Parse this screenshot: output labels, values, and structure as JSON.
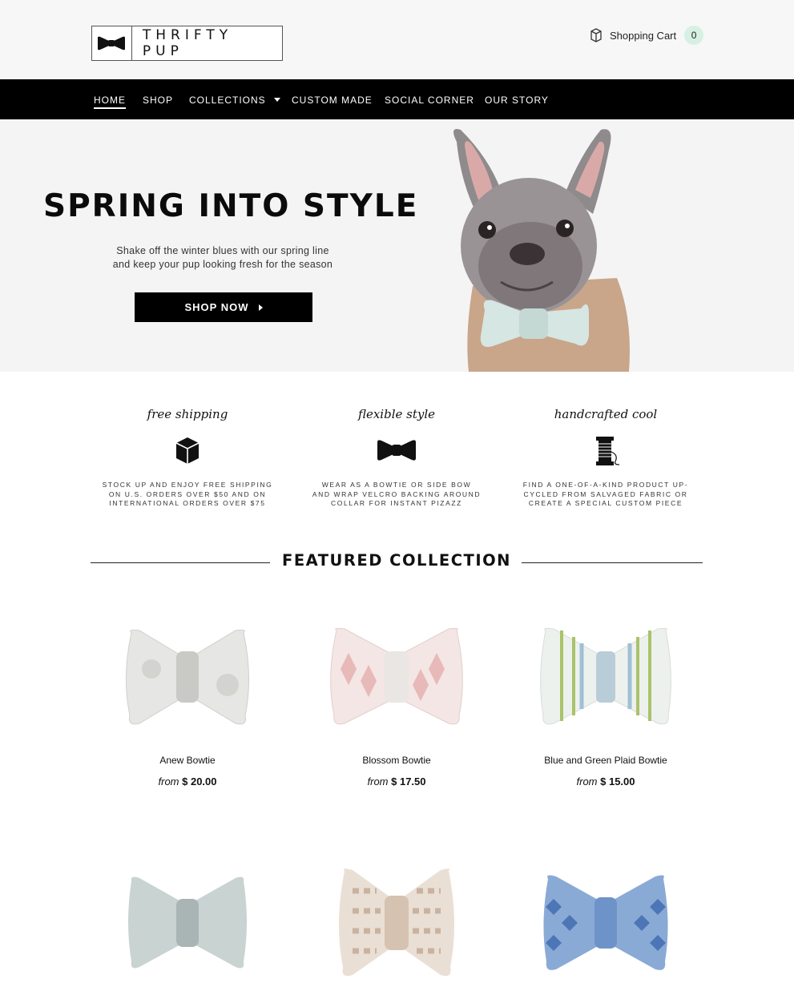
{
  "header": {
    "logo_text": "THRIFTY PUP",
    "cart_label": "Shopping Cart",
    "cart_count": "0"
  },
  "nav": {
    "items": [
      {
        "label": "HOME",
        "active": true
      },
      {
        "label": "SHOP"
      },
      {
        "label": "COLLECTIONS",
        "has_dropdown": true
      },
      {
        "label": "CUSTOM MADE"
      },
      {
        "label": "SOCIAL CORNER"
      },
      {
        "label": "OUR STORY"
      }
    ]
  },
  "hero": {
    "title": "SPRING INTO STYLE",
    "subtitle_line1": "Shake off the winter blues with our spring line",
    "subtitle_line2": "and keep your pup looking fresh for the season",
    "cta_label": "SHOP NOW"
  },
  "features": [
    {
      "title": "free shipping",
      "icon": "box-icon",
      "line1": "STOCK UP AND ENJOY FREE SHIPPING",
      "line2": "ON U.S. ORDERS OVER $50 AND ON",
      "line3": "INTERNATIONAL ORDERS OVER $75"
    },
    {
      "title": "flexible style",
      "icon": "bowtie-icon",
      "line1": "WEAR AS A BOWTIE OR SIDE BOW",
      "line2": "AND WRAP VELCRO BACKING AROUND",
      "line3": "COLLAR FOR INSTANT PIZAZZ"
    },
    {
      "title": "handcrafted cool",
      "icon": "thread-spool-icon",
      "line1": "FIND A ONE-OF-A-KIND PRODUCT UP-",
      "line2": "CYCLED FROM SALVAGED FABRIC OR",
      "line3": "CREATE A SPECIAL CUSTOM PIECE"
    }
  ],
  "featured": {
    "title": "FEATURED COLLECTION"
  },
  "products": [
    {
      "name": "Anew Bowtie",
      "from": "from",
      "price": "$ 20.00",
      "colors": [
        "#e6e6e4",
        "#c9c9c6"
      ]
    },
    {
      "name": "Blossom Bowtie",
      "from": "from",
      "price": "$ 17.50",
      "colors": [
        "#f3e6e4",
        "#e8b9b9"
      ]
    },
    {
      "name": "Blue and Green Plaid Bowtie",
      "from": "from",
      "price": "$ 15.00",
      "colors": [
        "#edf1ee",
        "#a9c36a"
      ]
    },
    {
      "name": "",
      "from": "",
      "price": "",
      "colors": [
        "#c9d3d1",
        "#a8b5b4"
      ]
    },
    {
      "name": "",
      "from": "",
      "price": "",
      "colors": [
        "#eadfd5",
        "#c9b3a0"
      ]
    },
    {
      "name": "",
      "from": "",
      "price": "",
      "colors": [
        "#8aaad6",
        "#4d76b6"
      ]
    }
  ]
}
